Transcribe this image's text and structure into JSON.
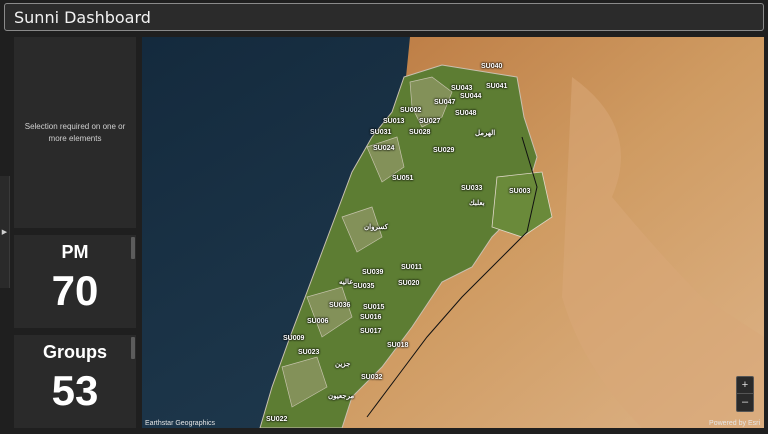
{
  "header": {
    "title": "Sunni Dashboard"
  },
  "sidebar_toggle": {
    "icon": "chevron-right-icon",
    "glyph": "▶"
  },
  "selection_panel": {
    "message": "Selection required on one or more elements"
  },
  "indicators": [
    {
      "label": "PM",
      "value": "70"
    },
    {
      "label": "Groups",
      "value": "53"
    }
  ],
  "map": {
    "attribution_left": "Earthstar Geographics",
    "attribution_right": "Powered by Esri",
    "zoom_in": "+",
    "zoom_out": "–",
    "labels": [
      "SU040",
      "SU041",
      "SU043",
      "SU044",
      "SU047",
      "SU048",
      "SU002",
      "SU013",
      "SU027",
      "SU031",
      "SU028",
      "SU024",
      "SU029",
      "SU051",
      "SU033",
      "SU003",
      "SU011",
      "SU039",
      "SU020",
      "SU035",
      "SU036",
      "SU015",
      "SU016",
      "SU006",
      "SU017",
      "SU009",
      "SU018",
      "SU023",
      "SU032",
      "SU022",
      "الهرمل",
      "بعلبك",
      "كسروان",
      "عاليه",
      "جزين",
      "مرجعيون"
    ]
  },
  "colors": {
    "header_border": "#8a8a8a",
    "panel_bg": "#2a2a2a",
    "sea": "#1d3346",
    "land": "#c9935a",
    "vegetation": "#5d7d33"
  }
}
